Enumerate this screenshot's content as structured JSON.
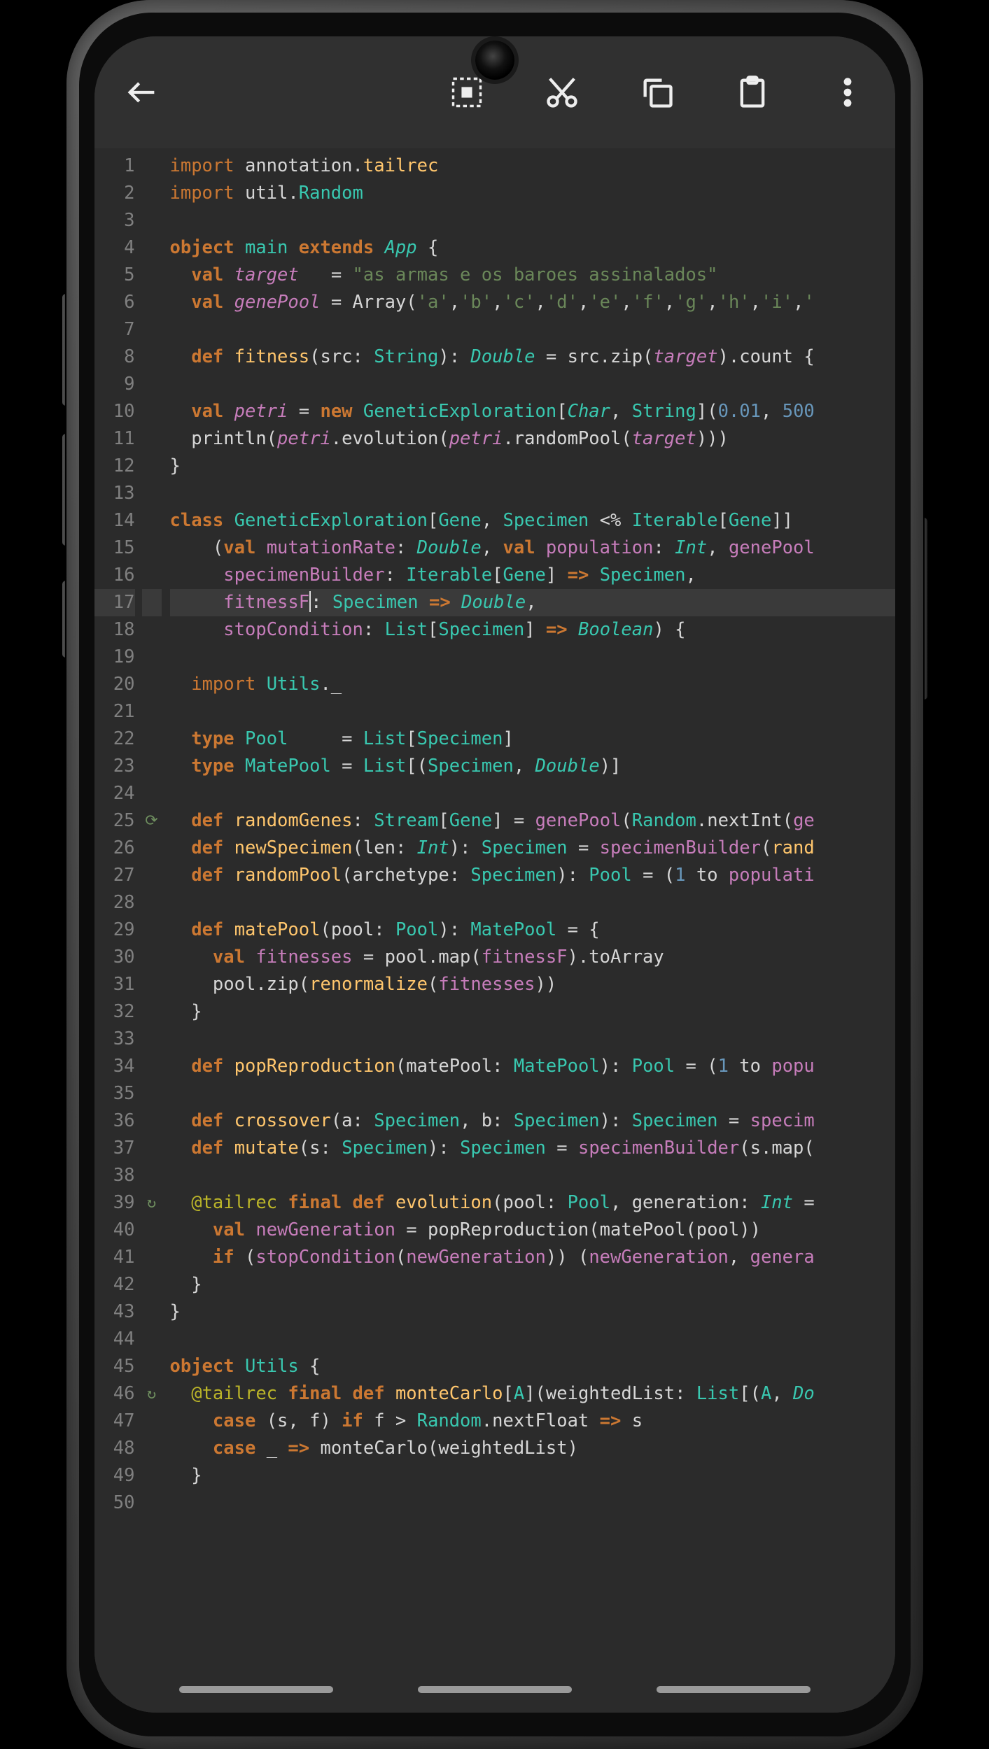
{
  "toolbar": {
    "back": "←",
    "select_all": "select-all",
    "cut": "cut",
    "copy": "copy",
    "paste": "paste",
    "more": "more"
  },
  "cursor_line": 17,
  "gutter_marks": {
    "25": "⟳",
    "39": "↻",
    "46": "↻"
  },
  "code_lines": [
    [
      {
        "c": "kw",
        "t": "import "
      },
      {
        "c": "default",
        "t": "annotation."
      },
      {
        "c": "fn",
        "t": "tailrec"
      }
    ],
    [
      {
        "c": "kw",
        "t": "import "
      },
      {
        "c": "default",
        "t": "util."
      },
      {
        "c": "cls",
        "t": "Random"
      }
    ],
    [
      {
        "c": "default",
        "t": ""
      }
    ],
    [
      {
        "c": "kw-b",
        "t": "object "
      },
      {
        "c": "cls",
        "t": "main"
      },
      {
        "c": "kw-b",
        "t": " extends "
      },
      {
        "c": "clsI",
        "t": "App"
      },
      {
        "c": "default",
        "t": " {"
      }
    ],
    [
      {
        "c": "default",
        "t": "  "
      },
      {
        "c": "kw-b",
        "t": "val "
      },
      {
        "c": "varI",
        "t": "target"
      },
      {
        "c": "default",
        "t": "   = "
      },
      {
        "c": "str",
        "t": "\"as armas e os baroes assinalados\""
      }
    ],
    [
      {
        "c": "default",
        "t": "  "
      },
      {
        "c": "kw-b",
        "t": "val "
      },
      {
        "c": "varI",
        "t": "genePool"
      },
      {
        "c": "default",
        "t": " = Array("
      },
      {
        "c": "str",
        "t": "'a'"
      },
      {
        "c": "default",
        "t": ","
      },
      {
        "c": "str",
        "t": "'b'"
      },
      {
        "c": "default",
        "t": ","
      },
      {
        "c": "str",
        "t": "'c'"
      },
      {
        "c": "default",
        "t": ","
      },
      {
        "c": "str",
        "t": "'d'"
      },
      {
        "c": "default",
        "t": ","
      },
      {
        "c": "str",
        "t": "'e'"
      },
      {
        "c": "default",
        "t": ","
      },
      {
        "c": "str",
        "t": "'f'"
      },
      {
        "c": "default",
        "t": ","
      },
      {
        "c": "str",
        "t": "'g'"
      },
      {
        "c": "default",
        "t": ","
      },
      {
        "c": "str",
        "t": "'h'"
      },
      {
        "c": "default",
        "t": ","
      },
      {
        "c": "str",
        "t": "'i'"
      },
      {
        "c": "default",
        "t": ","
      },
      {
        "c": "str",
        "t": "'"
      }
    ],
    [
      {
        "c": "default",
        "t": ""
      }
    ],
    [
      {
        "c": "default",
        "t": "  "
      },
      {
        "c": "kw-b",
        "t": "def "
      },
      {
        "c": "fn",
        "t": "fitness"
      },
      {
        "c": "default",
        "t": "(src: "
      },
      {
        "c": "cls",
        "t": "String"
      },
      {
        "c": "default",
        "t": "): "
      },
      {
        "c": "clsI",
        "t": "Double"
      },
      {
        "c": "default",
        "t": " = src.zip("
      },
      {
        "c": "varI",
        "t": "target"
      },
      {
        "c": "default",
        "t": ").count {"
      }
    ],
    [
      {
        "c": "default",
        "t": ""
      }
    ],
    [
      {
        "c": "default",
        "t": "  "
      },
      {
        "c": "kw-b",
        "t": "val "
      },
      {
        "c": "varI",
        "t": "petri"
      },
      {
        "c": "default",
        "t": " = "
      },
      {
        "c": "kw-b",
        "t": "new "
      },
      {
        "c": "cls",
        "t": "GeneticExploration"
      },
      {
        "c": "default",
        "t": "["
      },
      {
        "c": "clsI",
        "t": "Char"
      },
      {
        "c": "default",
        "t": ", "
      },
      {
        "c": "cls",
        "t": "String"
      },
      {
        "c": "default",
        "t": "]("
      },
      {
        "c": "num",
        "t": "0.01"
      },
      {
        "c": "default",
        "t": ", "
      },
      {
        "c": "num",
        "t": "500"
      }
    ],
    [
      {
        "c": "default",
        "t": "  println("
      },
      {
        "c": "varI",
        "t": "petri"
      },
      {
        "c": "default",
        "t": ".evolution("
      },
      {
        "c": "varI",
        "t": "petri"
      },
      {
        "c": "default",
        "t": ".randomPool("
      },
      {
        "c": "varI",
        "t": "target"
      },
      {
        "c": "default",
        "t": ")))"
      }
    ],
    [
      {
        "c": "default",
        "t": "}"
      }
    ],
    [
      {
        "c": "default",
        "t": ""
      }
    ],
    [
      {
        "c": "kw-b",
        "t": "class "
      },
      {
        "c": "cls",
        "t": "GeneticExploration"
      },
      {
        "c": "default",
        "t": "["
      },
      {
        "c": "cls",
        "t": "Gene"
      },
      {
        "c": "default",
        "t": ", "
      },
      {
        "c": "cls",
        "t": "Specimen"
      },
      {
        "c": "default",
        "t": " <% "
      },
      {
        "c": "cls",
        "t": "Iterable"
      },
      {
        "c": "default",
        "t": "["
      },
      {
        "c": "cls",
        "t": "Gene"
      },
      {
        "c": "default",
        "t": "]]"
      }
    ],
    [
      {
        "c": "default",
        "t": "    ("
      },
      {
        "c": "kw-b",
        "t": "val "
      },
      {
        "c": "var",
        "t": "mutationRate"
      },
      {
        "c": "default",
        "t": ": "
      },
      {
        "c": "clsI",
        "t": "Double"
      },
      {
        "c": "default",
        "t": ", "
      },
      {
        "c": "kw-b",
        "t": "val "
      },
      {
        "c": "var",
        "t": "population"
      },
      {
        "c": "default",
        "t": ": "
      },
      {
        "c": "clsI",
        "t": "Int"
      },
      {
        "c": "default",
        "t": ", "
      },
      {
        "c": "var",
        "t": "genePool"
      }
    ],
    [
      {
        "c": "default",
        "t": "     "
      },
      {
        "c": "var",
        "t": "specimenBuilder"
      },
      {
        "c": "default",
        "t": ": "
      },
      {
        "c": "cls",
        "t": "Iterable"
      },
      {
        "c": "default",
        "t": "["
      },
      {
        "c": "cls",
        "t": "Gene"
      },
      {
        "c": "default",
        "t": "] "
      },
      {
        "c": "kw-b",
        "t": "=>"
      },
      {
        "c": "default",
        "t": " "
      },
      {
        "c": "cls",
        "t": "Specimen"
      },
      {
        "c": "default",
        "t": ","
      }
    ],
    [
      {
        "c": "default",
        "t": "     "
      },
      {
        "c": "var",
        "t": "fitnessF"
      },
      {
        "caret": true
      },
      {
        "c": "default",
        "t": ": "
      },
      {
        "c": "cls",
        "t": "Specimen"
      },
      {
        "c": "default",
        "t": " "
      },
      {
        "c": "kw-b",
        "t": "=>"
      },
      {
        "c": "default",
        "t": " "
      },
      {
        "c": "clsI",
        "t": "Double"
      },
      {
        "c": "default",
        "t": ","
      }
    ],
    [
      {
        "c": "default",
        "t": "     "
      },
      {
        "c": "var",
        "t": "stopCondition"
      },
      {
        "c": "default",
        "t": ": "
      },
      {
        "c": "cls",
        "t": "List"
      },
      {
        "c": "default",
        "t": "["
      },
      {
        "c": "cls",
        "t": "Specimen"
      },
      {
        "c": "default",
        "t": "] "
      },
      {
        "c": "kw-b",
        "t": "=>"
      },
      {
        "c": "default",
        "t": " "
      },
      {
        "c": "clsI",
        "t": "Boolean"
      },
      {
        "c": "default",
        "t": ") {"
      }
    ],
    [
      {
        "c": "default",
        "t": ""
      }
    ],
    [
      {
        "c": "default",
        "t": "  "
      },
      {
        "c": "kw",
        "t": "import "
      },
      {
        "c": "cls",
        "t": "Utils"
      },
      {
        "c": "default",
        "t": "._"
      }
    ],
    [
      {
        "c": "default",
        "t": ""
      }
    ],
    [
      {
        "c": "default",
        "t": "  "
      },
      {
        "c": "kw-b",
        "t": "type "
      },
      {
        "c": "cls",
        "t": "Pool"
      },
      {
        "c": "default",
        "t": "     = "
      },
      {
        "c": "cls",
        "t": "List"
      },
      {
        "c": "default",
        "t": "["
      },
      {
        "c": "cls",
        "t": "Specimen"
      },
      {
        "c": "default",
        "t": "]"
      }
    ],
    [
      {
        "c": "default",
        "t": "  "
      },
      {
        "c": "kw-b",
        "t": "type "
      },
      {
        "c": "cls",
        "t": "MatePool"
      },
      {
        "c": "default",
        "t": " = "
      },
      {
        "c": "cls",
        "t": "List"
      },
      {
        "c": "default",
        "t": "[("
      },
      {
        "c": "cls",
        "t": "Specimen"
      },
      {
        "c": "default",
        "t": ", "
      },
      {
        "c": "clsI",
        "t": "Double"
      },
      {
        "c": "default",
        "t": ")]"
      }
    ],
    [
      {
        "c": "default",
        "t": ""
      }
    ],
    [
      {
        "c": "default",
        "t": "  "
      },
      {
        "c": "kw-b",
        "t": "def "
      },
      {
        "c": "fn",
        "t": "randomGenes"
      },
      {
        "c": "default",
        "t": ": "
      },
      {
        "c": "cls",
        "t": "Stream"
      },
      {
        "c": "default",
        "t": "["
      },
      {
        "c": "cls",
        "t": "Gene"
      },
      {
        "c": "default",
        "t": "] = "
      },
      {
        "c": "var",
        "t": "genePool"
      },
      {
        "c": "default",
        "t": "("
      },
      {
        "c": "cls",
        "t": "Random"
      },
      {
        "c": "default",
        "t": ".nextInt("
      },
      {
        "c": "var",
        "t": "ge"
      }
    ],
    [
      {
        "c": "default",
        "t": "  "
      },
      {
        "c": "kw-b",
        "t": "def "
      },
      {
        "c": "fn",
        "t": "newSpecimen"
      },
      {
        "c": "default",
        "t": "(len: "
      },
      {
        "c": "clsI",
        "t": "Int"
      },
      {
        "c": "default",
        "t": "): "
      },
      {
        "c": "cls",
        "t": "Specimen"
      },
      {
        "c": "default",
        "t": " = "
      },
      {
        "c": "var",
        "t": "specimenBuilder"
      },
      {
        "c": "default",
        "t": "("
      },
      {
        "c": "fn",
        "t": "rand"
      }
    ],
    [
      {
        "c": "default",
        "t": "  "
      },
      {
        "c": "kw-b",
        "t": "def "
      },
      {
        "c": "fn",
        "t": "randomPool"
      },
      {
        "c": "default",
        "t": "(archetype: "
      },
      {
        "c": "cls",
        "t": "Specimen"
      },
      {
        "c": "default",
        "t": "): "
      },
      {
        "c": "cls",
        "t": "Pool"
      },
      {
        "c": "default",
        "t": " = ("
      },
      {
        "c": "num",
        "t": "1"
      },
      {
        "c": "default",
        "t": " to "
      },
      {
        "c": "var",
        "t": "populati"
      }
    ],
    [
      {
        "c": "default",
        "t": ""
      }
    ],
    [
      {
        "c": "default",
        "t": "  "
      },
      {
        "c": "kw-b",
        "t": "def "
      },
      {
        "c": "fn",
        "t": "matePool"
      },
      {
        "c": "default",
        "t": "(pool: "
      },
      {
        "c": "cls",
        "t": "Pool"
      },
      {
        "c": "default",
        "t": "): "
      },
      {
        "c": "cls",
        "t": "MatePool"
      },
      {
        "c": "default",
        "t": " = {"
      }
    ],
    [
      {
        "c": "default",
        "t": "    "
      },
      {
        "c": "kw-b",
        "t": "val "
      },
      {
        "c": "var",
        "t": "fitnesses"
      },
      {
        "c": "default",
        "t": " = pool.map("
      },
      {
        "c": "var",
        "t": "fitnessF"
      },
      {
        "c": "default",
        "t": ").toArray"
      }
    ],
    [
      {
        "c": "default",
        "t": "    pool.zip("
      },
      {
        "c": "fn",
        "t": "renormalize"
      },
      {
        "c": "default",
        "t": "("
      },
      {
        "c": "var",
        "t": "fitnesses"
      },
      {
        "c": "default",
        "t": "))"
      }
    ],
    [
      {
        "c": "default",
        "t": "  }"
      }
    ],
    [
      {
        "c": "default",
        "t": ""
      }
    ],
    [
      {
        "c": "default",
        "t": "  "
      },
      {
        "c": "kw-b",
        "t": "def "
      },
      {
        "c": "fn",
        "t": "popReproduction"
      },
      {
        "c": "default",
        "t": "(matePool: "
      },
      {
        "c": "cls",
        "t": "MatePool"
      },
      {
        "c": "default",
        "t": "): "
      },
      {
        "c": "cls",
        "t": "Pool"
      },
      {
        "c": "default",
        "t": " = ("
      },
      {
        "c": "num",
        "t": "1"
      },
      {
        "c": "default",
        "t": " to "
      },
      {
        "c": "var",
        "t": "popu"
      }
    ],
    [
      {
        "c": "default",
        "t": ""
      }
    ],
    [
      {
        "c": "default",
        "t": "  "
      },
      {
        "c": "kw-b",
        "t": "def "
      },
      {
        "c": "fn",
        "t": "crossover"
      },
      {
        "c": "default",
        "t": "(a: "
      },
      {
        "c": "cls",
        "t": "Specimen"
      },
      {
        "c": "default",
        "t": ", b: "
      },
      {
        "c": "cls",
        "t": "Specimen"
      },
      {
        "c": "default",
        "t": "): "
      },
      {
        "c": "cls",
        "t": "Specimen"
      },
      {
        "c": "default",
        "t": " = "
      },
      {
        "c": "var",
        "t": "specim"
      }
    ],
    [
      {
        "c": "default",
        "t": "  "
      },
      {
        "c": "kw-b",
        "t": "def "
      },
      {
        "c": "fn",
        "t": "mutate"
      },
      {
        "c": "default",
        "t": "(s: "
      },
      {
        "c": "cls",
        "t": "Specimen"
      },
      {
        "c": "default",
        "t": "): "
      },
      {
        "c": "cls",
        "t": "Specimen"
      },
      {
        "c": "default",
        "t": " = "
      },
      {
        "c": "var",
        "t": "specimenBuilder"
      },
      {
        "c": "default",
        "t": "(s.map("
      }
    ],
    [
      {
        "c": "default",
        "t": ""
      }
    ],
    [
      {
        "c": "default",
        "t": "  "
      },
      {
        "c": "ann",
        "t": "@tailrec"
      },
      {
        "c": "default",
        "t": " "
      },
      {
        "c": "kw-b",
        "t": "final def "
      },
      {
        "c": "fn",
        "t": "evolution"
      },
      {
        "c": "default",
        "t": "(pool: "
      },
      {
        "c": "cls",
        "t": "Pool"
      },
      {
        "c": "default",
        "t": ", generation: "
      },
      {
        "c": "clsI",
        "t": "Int"
      },
      {
        "c": "default",
        "t": " ="
      }
    ],
    [
      {
        "c": "default",
        "t": "    "
      },
      {
        "c": "kw-b",
        "t": "val "
      },
      {
        "c": "var",
        "t": "newGeneration"
      },
      {
        "c": "default",
        "t": " = popReproduction(matePool(pool))"
      }
    ],
    [
      {
        "c": "default",
        "t": "    "
      },
      {
        "c": "kw-b",
        "t": "if "
      },
      {
        "c": "default",
        "t": "("
      },
      {
        "c": "var",
        "t": "stopCondition"
      },
      {
        "c": "default",
        "t": "("
      },
      {
        "c": "var",
        "t": "newGeneration"
      },
      {
        "c": "default",
        "t": ")) ("
      },
      {
        "c": "var",
        "t": "newGeneration"
      },
      {
        "c": "default",
        "t": ", "
      },
      {
        "c": "var",
        "t": "genera"
      }
    ],
    [
      {
        "c": "default",
        "t": "  }"
      }
    ],
    [
      {
        "c": "default",
        "t": "}"
      }
    ],
    [
      {
        "c": "default",
        "t": ""
      }
    ],
    [
      {
        "c": "kw-b",
        "t": "object "
      },
      {
        "c": "cls",
        "t": "Utils"
      },
      {
        "c": "default",
        "t": " {"
      }
    ],
    [
      {
        "c": "default",
        "t": "  "
      },
      {
        "c": "ann",
        "t": "@tailrec"
      },
      {
        "c": "default",
        "t": " "
      },
      {
        "c": "kw-b",
        "t": "final def "
      },
      {
        "c": "fn",
        "t": "monteCarlo"
      },
      {
        "c": "default",
        "t": "["
      },
      {
        "c": "cls",
        "t": "A"
      },
      {
        "c": "default",
        "t": "](weightedList: "
      },
      {
        "c": "cls",
        "t": "List"
      },
      {
        "c": "default",
        "t": "[("
      },
      {
        "c": "cls",
        "t": "A"
      },
      {
        "c": "default",
        "t": ", "
      },
      {
        "c": "clsI",
        "t": "Do"
      }
    ],
    [
      {
        "c": "default",
        "t": "    "
      },
      {
        "c": "kw-b",
        "t": "case "
      },
      {
        "c": "default",
        "t": "(s, f) "
      },
      {
        "c": "kw-b",
        "t": "if "
      },
      {
        "c": "default",
        "t": "f > "
      },
      {
        "c": "cls",
        "t": "Random"
      },
      {
        "c": "default",
        "t": ".nextFloat "
      },
      {
        "c": "kw-b",
        "t": "=>"
      },
      {
        "c": "default",
        "t": " s"
      }
    ],
    [
      {
        "c": "default",
        "t": "    "
      },
      {
        "c": "kw-b",
        "t": "case "
      },
      {
        "c": "default",
        "t": "_ "
      },
      {
        "c": "kw-b",
        "t": "=>"
      },
      {
        "c": "default",
        "t": " monteCarlo(weightedList)"
      }
    ],
    [
      {
        "c": "default",
        "t": "  }"
      }
    ],
    [
      {
        "c": "default",
        "t": ""
      }
    ]
  ]
}
